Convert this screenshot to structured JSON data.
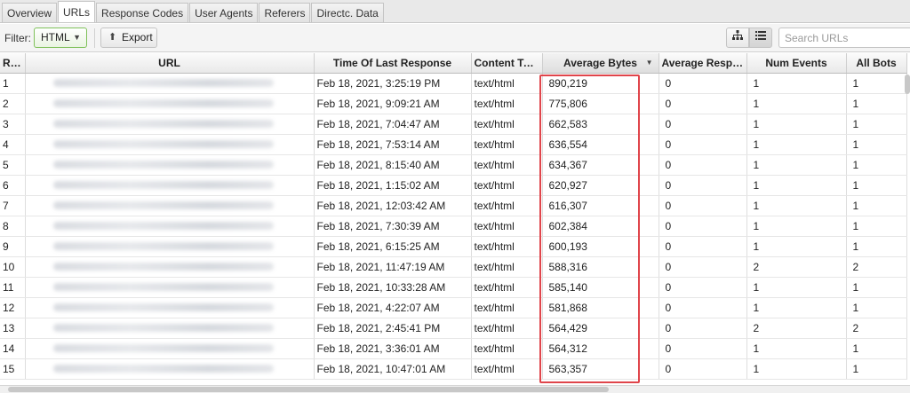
{
  "tabs": [
    {
      "label": "Overview",
      "active": false
    },
    {
      "label": "URLs",
      "active": true
    },
    {
      "label": "Response Codes",
      "active": false
    },
    {
      "label": "User Agents",
      "active": false
    },
    {
      "label": "Referers",
      "active": false
    },
    {
      "label": "Directc. Data",
      "active": false
    }
  ],
  "toolbar": {
    "filter_label": "Filter:",
    "filter_value": "HTML",
    "export_label": "Export",
    "search_placeholder": "Search URLs"
  },
  "table": {
    "columns": [
      "Row",
      "URL",
      "Time Of Last Response",
      "Content Type",
      "Average Bytes",
      "Average Respo...",
      "Num Events",
      "All Bots"
    ],
    "sorted_column": "Average Bytes",
    "rows": [
      [
        "1",
        "Feb 18, 2021, 3:25:19 PM",
        "text/html",
        "890,219",
        "0",
        "1",
        "1"
      ],
      [
        "2",
        "Feb 18, 2021, 9:09:21 AM",
        "text/html",
        "775,806",
        "0",
        "1",
        "1"
      ],
      [
        "3",
        "Feb 18, 2021, 7:04:47 AM",
        "text/html",
        "662,583",
        "0",
        "1",
        "1"
      ],
      [
        "4",
        "Feb 18, 2021, 7:53:14 AM",
        "text/html",
        "636,554",
        "0",
        "1",
        "1"
      ],
      [
        "5",
        "Feb 18, 2021, 8:15:40 AM",
        "text/html",
        "634,367",
        "0",
        "1",
        "1"
      ],
      [
        "6",
        "Feb 18, 2021, 1:15:02 AM",
        "text/html",
        "620,927",
        "0",
        "1",
        "1"
      ],
      [
        "7",
        "Feb 18, 2021, 12:03:42 AM",
        "text/html",
        "616,307",
        "0",
        "1",
        "1"
      ],
      [
        "8",
        "Feb 18, 2021, 7:30:39 AM",
        "text/html",
        "602,384",
        "0",
        "1",
        "1"
      ],
      [
        "9",
        "Feb 18, 2021, 6:15:25 AM",
        "text/html",
        "600,193",
        "0",
        "1",
        "1"
      ],
      [
        "10",
        "Feb 18, 2021, 11:47:19 AM",
        "text/html",
        "588,316",
        "0",
        "2",
        "2"
      ],
      [
        "11",
        "Feb 18, 2021, 10:33:28 AM",
        "text/html",
        "585,140",
        "0",
        "1",
        "1"
      ],
      [
        "12",
        "Feb 18, 2021, 4:22:07 AM",
        "text/html",
        "581,868",
        "0",
        "1",
        "1"
      ],
      [
        "13",
        "Feb 18, 2021, 2:45:41 PM",
        "text/html",
        "564,429",
        "0",
        "2",
        "2"
      ],
      [
        "14",
        "Feb 18, 2021, 3:36:01 AM",
        "text/html",
        "564,312",
        "0",
        "1",
        "1"
      ],
      [
        "15",
        "Feb 18, 2021, 10:47:01 AM",
        "text/html",
        "563,357",
        "0",
        "1",
        "1"
      ]
    ]
  },
  "colors": {
    "highlight": "#e0454b",
    "filter_border": "#7fc15a"
  },
  "icons": {
    "export": "export-icon",
    "tree_view": "tree-view-icon",
    "list_view": "list-view-icon",
    "sort": "sort-desc-icon"
  }
}
